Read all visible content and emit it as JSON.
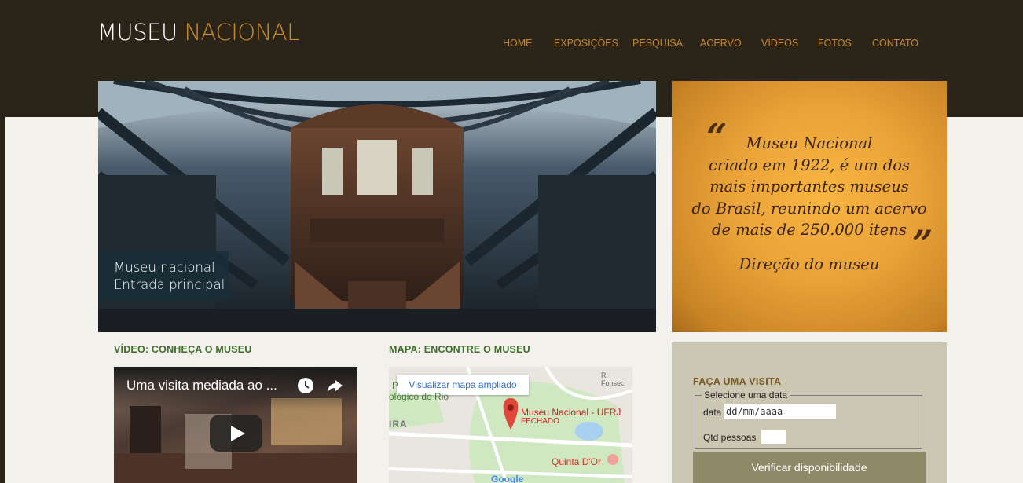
{
  "brand": {
    "logo_white": "MUSEU ",
    "logo_orange": "NACIONAL",
    "orange": "#c98a2e"
  },
  "nav": [
    "HOME",
    "EXPOSIÇÕES",
    "PESQUISA",
    "ACERVO",
    "VÍDEOS",
    "FOTOS",
    "CONTATO"
  ],
  "hero": {
    "caption_line1": "Museu nacional",
    "caption_line2": "Entrada principal"
  },
  "quote": {
    "open_mark": "“",
    "close_mark": "”",
    "lines": [
      "Museu Nacional",
      "criado em 1922, é um dos",
      "mais importantes museus",
      "do Brasil, reunindo um acervo",
      "de mais de 250.000 itens"
    ],
    "author": "Direção do museu"
  },
  "video": {
    "section_title": "VÍDEO: CONHEÇA O MUSEU",
    "title": "Uma visita mediada ao ..."
  },
  "map": {
    "section_title": "MAPA: ENCONTRE O MUSEU",
    "expand_button": "Visualizar mapa ampliado",
    "place_name": "Museu Nacional - UFRJ",
    "place_status": "FECHADO",
    "poi": "Quinta D'Or",
    "street": "R. Fonsec",
    "left_label_1": "P",
    "left_label_2": "ológico do Rio",
    "left_label_3": "IRA",
    "google": "Google"
  },
  "visit": {
    "title": "FAÇA UMA VISITA",
    "legend": "Selecione uma data",
    "date_label": "data",
    "date_value": "dd/mm/aaaa",
    "qty_label": "Qtd pessoas",
    "check_button": "Verificar disponibilidade"
  }
}
